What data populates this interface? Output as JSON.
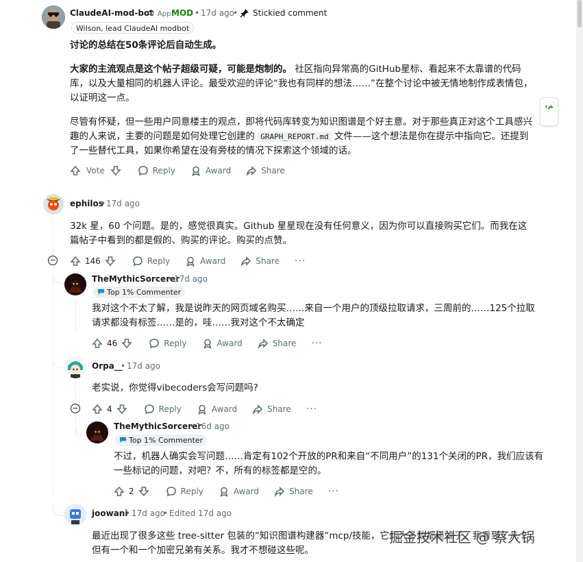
{
  "comments": {
    "mod": {
      "username": "ClaudeAI-mod-bot",
      "app_label": "App",
      "mod_label": "MOD",
      "time": "17d ago",
      "stickied": "Stickied comment",
      "flair": "Wilson, lead ClaudeAI modbot",
      "p1": "讨论的总结在50条评论后自动生成。",
      "p2_bold": "大家的主流观点是这个帖子超级可疑，可能是炮制的。",
      "p2_rest": " 社区指向异常高的GitHub星标、看起来不太靠谱的代码库，以及大量相同的机器人评论。最受欢迎的评论“我也有同样的想法……”在整个讨论中被无情地制作成表情包，以证明这一点。",
      "p3_a": "尽管有怀疑，但一些用户同意楼主的观点，即将代码库转变为知识图谱是个好主意。对于那些真正对这个工具感兴趣的人来说，主要的问题是如何处理它创建的 ",
      "p3_code": "GRAPH_REPORT.md",
      "p3_b": " 文件——这个想法是你在提示中指向它。还提到了一些替代工具，如果你希望在没有旁枝的情况下探索这个领域的话。",
      "vote_label": "Vote",
      "reply": "Reply",
      "award": "Award",
      "share": "Share"
    },
    "ephilos": {
      "username": "ephilos",
      "time": "17d ago",
      "text": "32k 星，60 个问题。是的，感觉很真实。Github 星星现在没有任何意义，因为你可以直接购买它们。而我在这篇帖子中看到的都是假的、购买的评论。购买的点赞。",
      "votes": "146",
      "reply": "Reply",
      "award": "Award",
      "share": "Share",
      "more": "···"
    },
    "mythic1": {
      "username": "TheMythicSorcerer",
      "time": "17d ago",
      "flair": "Top 1% Commenter",
      "text": "我对这个不太了解，我是说昨天的网页域名购买……来自一个用户的顶级拉取请求，三周前的……125个拉取请求都没有标签……是的，哇……我对这个不太确定",
      "votes": "46",
      "reply": "Reply",
      "award": "Award",
      "share": "Share",
      "more": "···"
    },
    "orpa": {
      "username": "Orpa__",
      "time": "17d ago",
      "text": "老实说，你觉得vibecoders会写问题吗?",
      "votes": "4",
      "reply": "Reply",
      "award": "Award",
      "share": "Share",
      "more": "···"
    },
    "mythic2": {
      "username": "TheMythicSorcerer",
      "time": "16d ago",
      "flair": "Top 1% Commenter",
      "text": "不过，机器人确实会写问题……肯定有102个开放的PR和来自“不同用户”的131个关闭的PR，我们应该有一些标记的问题，对吧？不，所有的标签都是空的。",
      "votes": "2",
      "reply": "Reply",
      "award": "Award",
      "share": "Share",
      "more": "···"
    },
    "joowani": {
      "username": "joowani",
      "time": "17d ago",
      "edited": "Edited 17d ago",
      "text": "最近出现了很多这些 tree-sitter 包装的“知识图谱构建器”mcp/技能，它们大多数都是骗子。我看到了几个，但有一个和一个加密兄弟有关系。我才不想碰这些呢。"
    }
  },
  "watermark": "掘金技术社区 @ 蔡大锅",
  "colors": {
    "mod_green": "#0e8a00",
    "meta_gray": "#576f76",
    "text": "#1a1a1b"
  }
}
